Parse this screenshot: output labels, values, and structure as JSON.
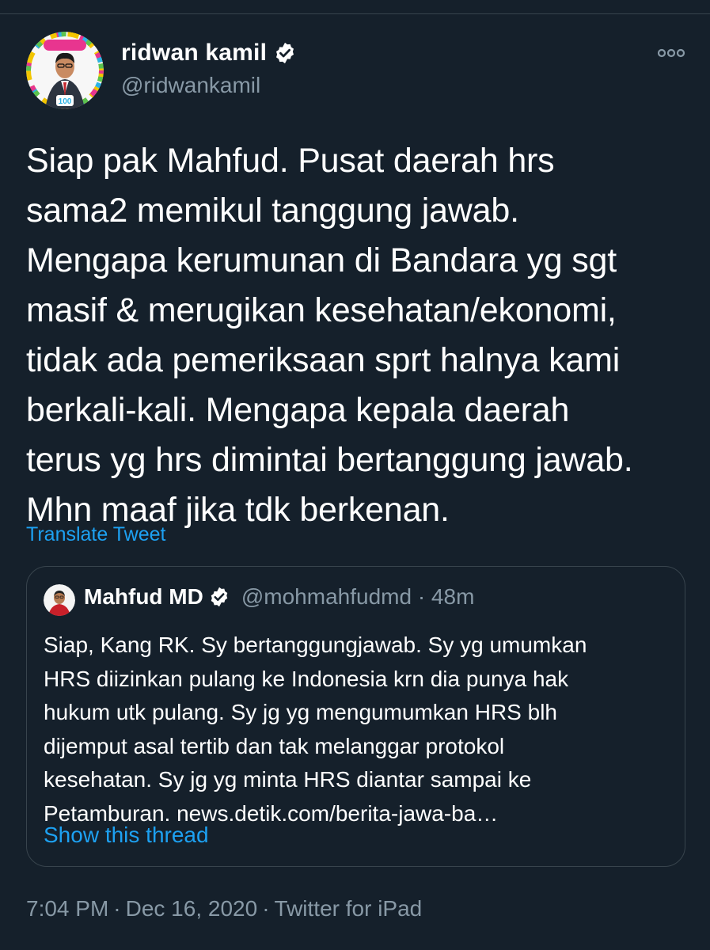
{
  "tweet": {
    "author": {
      "name": "ridwan kamil",
      "handle": "@ridwankamil",
      "avatar_badge_text": "#100Tahun78",
      "avatar_badge_number": "100"
    },
    "text": "Siap pak Mahfud. Pusat daerah hrs\nsama2 memikul tanggung jawab.\nMengapa kerumunan di Bandara yg sgt\nmasif & merugikan kesehatan/ekonomi,\ntidak ada pemeriksaan sprt halnya kami\nberkali-kali. Mengapa kepala daerah\nterus yg hrs dimintai bertanggung jawab.\nMhn maaf jika tdk berkenan.",
    "translate_label": "Translate Tweet",
    "timestamp": {
      "time": "7:04 PM",
      "separator": "·",
      "date": "Dec 16, 2020",
      "client": "Twitter for iPad"
    }
  },
  "quoted_tweet": {
    "author_name": "Mahfud MD",
    "meta": "@mohmahfudmd · 48m",
    "text": "Siap, Kang RK. Sy bertanggungjawab. Sy yg umumkan\nHRS diizinkan pulang ke Indonesia krn dia punya hak\nhukum utk pulang. Sy jg yg mengumumkan HRS blh\ndijemput asal tertib dan tak melanggar protokol\nkesehatan. Sy jg yg minta HRS diantar sampai ke\nPetamburan. ",
    "link": "news.detik.com/berita-jawa-ba…",
    "show_thread_label": "Show this thread"
  },
  "colors": {
    "background": "#15202b",
    "text_primary": "#ffffff",
    "text_secondary": "#8899a6",
    "accent": "#1da1f2",
    "border": "#38444d"
  },
  "icons": {
    "verified": "verified-badge-icon",
    "more": "more-options-icon"
  }
}
